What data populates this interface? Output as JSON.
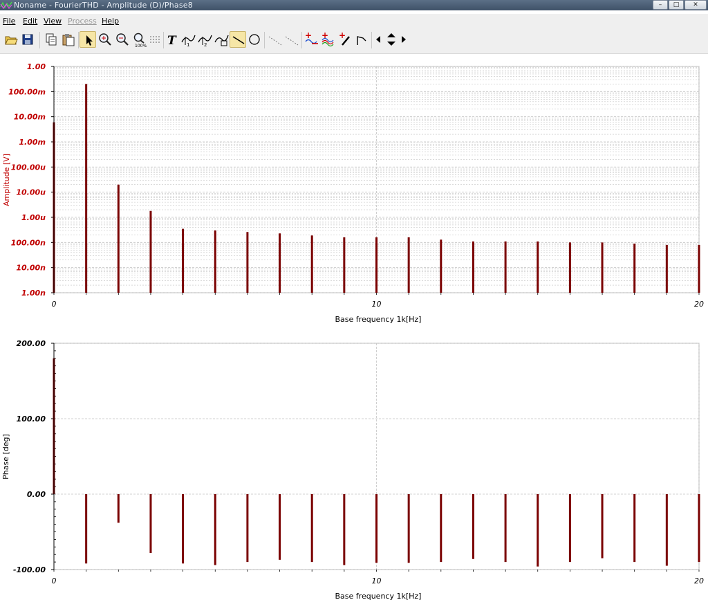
{
  "window": {
    "title": "Noname - FourierTHD - Amplitude (D)/Phase8",
    "buttons": [
      "minimize-icon",
      "maximize-icon",
      "close-icon"
    ]
  },
  "menu": [
    {
      "label": "File",
      "enabled": true
    },
    {
      "label": "Edit",
      "enabled": true
    },
    {
      "label": "View",
      "enabled": true
    },
    {
      "label": "Process",
      "enabled": false
    },
    {
      "label": "Help",
      "enabled": true
    }
  ],
  "toolbar": [
    {
      "name": "open-folder-icon",
      "active": false
    },
    {
      "name": "save-icon",
      "active": false
    },
    {
      "name": "copy-icon",
      "active": false
    },
    {
      "name": "paste-icon",
      "active": false
    },
    {
      "name": "select-pointer-icon",
      "active": true
    },
    {
      "name": "zoom-in-icon",
      "active": false
    },
    {
      "name": "zoom-out-icon",
      "active": false
    },
    {
      "name": "zoom-100-icon",
      "active": false
    },
    {
      "name": "grid-icon",
      "active": false
    },
    {
      "name": "text-tool-icon",
      "active": false
    },
    {
      "name": "cursor-curve-1-icon",
      "active": false
    },
    {
      "name": "cursor-curve-2-icon",
      "active": false
    },
    {
      "name": "cursor-curve-3-icon",
      "active": false
    },
    {
      "name": "line-tool-icon",
      "active": true
    },
    {
      "name": "ellipse-tool-icon",
      "active": false
    },
    {
      "name": "dashed-line-1-icon",
      "active": false
    },
    {
      "name": "dashed-line-2-icon",
      "active": false
    },
    {
      "name": "add-curve-icon",
      "active": false
    },
    {
      "name": "add-multi-curve-icon",
      "active": false
    },
    {
      "name": "pen-marker-icon",
      "active": false
    },
    {
      "name": "flag-marker-icon",
      "active": false
    },
    {
      "name": "arrow-left-icon",
      "active": false
    },
    {
      "name": "arrow-up-down-icon",
      "active": false
    },
    {
      "name": "arrow-right-icon",
      "active": false
    }
  ],
  "colors": {
    "stem": "#7a0000",
    "amplitude_axis": "#c00000",
    "grid": "#c4c4c4"
  },
  "chart_data": [
    {
      "type": "bar",
      "subtype": "stem",
      "ylabel": "Amplitude [V]",
      "xlabel": "Base frequency 1k[Hz]",
      "yscale": "log",
      "ylim": [
        1e-09,
        1
      ],
      "xlim": [
        0,
        20
      ],
      "y_ticks": [
        {
          "label": "1.00",
          "value": 1
        },
        {
          "label": "100.00m",
          "value": 0.1
        },
        {
          "label": "10.00m",
          "value": 0.01
        },
        {
          "label": "1.00m",
          "value": 0.001
        },
        {
          "label": "100.00u",
          "value": 0.0001
        },
        {
          "label": "10.00u",
          "value": 1e-05
        },
        {
          "label": "1.00u",
          "value": 1e-06
        },
        {
          "label": "100.00n",
          "value": 1e-07
        },
        {
          "label": "10.00n",
          "value": 1e-08
        },
        {
          "label": "1.00n",
          "value": 1e-09
        }
      ],
      "x_ticks": [
        {
          "label": "0",
          "value": 0
        },
        {
          "label": "10",
          "value": 10
        },
        {
          "label": "20",
          "value": 20
        }
      ],
      "grid": true,
      "x": [
        0,
        1,
        2,
        3,
        4,
        5,
        6,
        7,
        8,
        9,
        10,
        11,
        12,
        13,
        14,
        15,
        16,
        17,
        18,
        19,
        20
      ],
      "values": [
        0.006,
        0.2,
        2e-05,
        1.8e-06,
        3.5e-07,
        3e-07,
        2.6e-07,
        2.3e-07,
        1.9e-07,
        1.6e-07,
        1.6e-07,
        1.6e-07,
        1.3e-07,
        1.1e-07,
        1.1e-07,
        1.1e-07,
        1e-07,
        1e-07,
        9e-08,
        8e-08,
        8e-08
      ]
    },
    {
      "type": "bar",
      "subtype": "stem",
      "ylabel": "Phase [deg]",
      "xlabel": "Base frequency 1k[Hz]",
      "ylim": [
        -100,
        200
      ],
      "xlim": [
        0,
        20
      ],
      "y_ticks": [
        {
          "label": "200.00",
          "value": 200
        },
        {
          "label": "100.00",
          "value": 100
        },
        {
          "label": "0.00",
          "value": 0
        },
        {
          "label": "-100.00",
          "value": -100
        }
      ],
      "x_ticks": [
        {
          "label": "0",
          "value": 0
        },
        {
          "label": "10",
          "value": 10
        },
        {
          "label": "20",
          "value": 20
        }
      ],
      "grid": true,
      "x": [
        0,
        1,
        2,
        3,
        4,
        5,
        6,
        7,
        8,
        9,
        10,
        11,
        12,
        13,
        14,
        15,
        16,
        17,
        18,
        19,
        20
      ],
      "values": [
        180,
        -92,
        -38,
        -78,
        -92,
        -94,
        -90,
        -87,
        -90,
        -94,
        -91,
        -91,
        -90,
        -86,
        -90,
        -96,
        -90,
        -85,
        -90,
        -95,
        -90
      ]
    }
  ]
}
